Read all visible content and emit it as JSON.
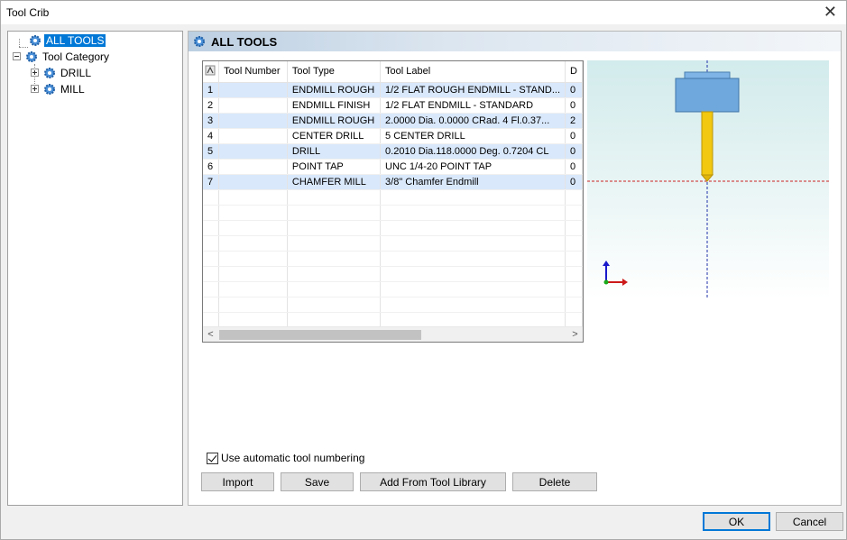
{
  "window": {
    "title": "Tool Crib",
    "close_glyph": "✕"
  },
  "tree": {
    "root": {
      "label": "ALL TOOLS",
      "icon": "gear-icon"
    },
    "category": {
      "label": "Tool Category",
      "icon": "gear-icon"
    },
    "children": [
      {
        "label": "DRILL",
        "icon": "gear-icon"
      },
      {
        "label": "MILL",
        "icon": "gear-icon"
      }
    ]
  },
  "panel": {
    "header": "ALL TOOLS",
    "icon": "gear-icon"
  },
  "grid": {
    "columns": [
      "Tool Number",
      "Tool Type",
      "Tool Label",
      "D"
    ],
    "rows": [
      [
        "1",
        "ENDMILL ROUGH",
        "1/2 FLAT ROUGH ENDMILL - STAND...",
        "0"
      ],
      [
        "2",
        "ENDMILL FINISH",
        "1/2 FLAT ENDMILL - STANDARD",
        "0"
      ],
      [
        "3",
        "ENDMILL ROUGH",
        "2.0000 Dia. 0.0000 CRad. 4 Fl.0.37...",
        "2"
      ],
      [
        "4",
        "CENTER DRILL",
        "5 CENTER DRILL",
        "0"
      ],
      [
        "5",
        "DRILL",
        "0.2010 Dia.118.0000 Deg. 0.7204 CL",
        "0"
      ],
      [
        "6",
        "POINT TAP",
        "UNC  1/4-20  POINT TAP",
        "0"
      ],
      [
        "7",
        "CHAMFER MILL",
        "3/8\" Chamfer Endmill",
        "0"
      ]
    ],
    "scroll_left": "<",
    "scroll_right": ">"
  },
  "options": {
    "auto_numbering_label": "Use automatic tool numbering",
    "auto_numbering_checked": true
  },
  "buttons": {
    "import": "Import",
    "save": "Save",
    "add_from_library": "Add From Tool Library",
    "delete": "Delete",
    "ok": "OK",
    "cancel": "Cancel"
  },
  "colors": {
    "selection": "#0078d7",
    "row_alt": "#d9e8fb",
    "tool_holder": "#6fa8dc",
    "tool_shank": "#f1c40f"
  }
}
